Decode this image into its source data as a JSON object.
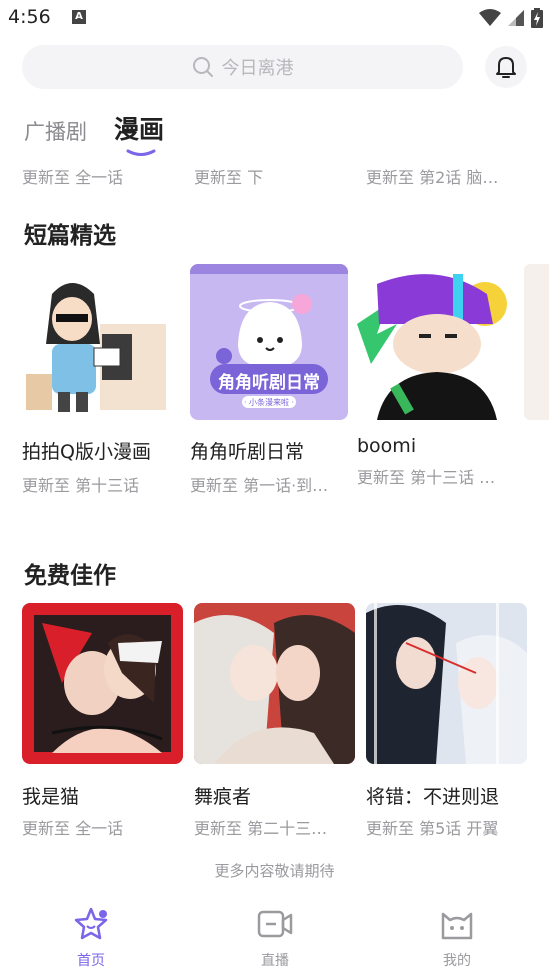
{
  "status_bar": {
    "time": "4:56",
    "notif_badge": "A"
  },
  "search": {
    "placeholder": "今日离港"
  },
  "tabs": [
    {
      "label": "广播剧"
    },
    {
      "label": "漫画"
    }
  ],
  "top_row_updates": [
    "更新至 全一话",
    "更新至 下",
    "更新至 第2话 脑…"
  ],
  "short_picks": {
    "title": "短篇精选",
    "items": [
      {
        "title": "拍拍Q版小漫画",
        "update": "更新至 第十三话"
      },
      {
        "title": "角角听剧日常",
        "update": "更新至 第一话·到…",
        "cover_caption": "角角听剧日常",
        "cover_subcaption": "· 小条漫来啦 ·"
      },
      {
        "title": "boomi",
        "update": "更新至 第十三话 …"
      }
    ]
  },
  "free_picks": {
    "title": "免费佳作",
    "items": [
      {
        "title": "我是猫",
        "update": "更新至 全一话"
      },
      {
        "title": "舞痕者",
        "update": "更新至 第二十三…"
      },
      {
        "title": "将错：不进则退",
        "update": "更新至 第5话 开翼"
      }
    ]
  },
  "footer_note": "更多内容敬请期待",
  "bottom_nav": [
    {
      "label": "首页",
      "icon": "star-face-icon",
      "active": true
    },
    {
      "label": "直播",
      "icon": "video-icon",
      "active": false
    },
    {
      "label": "我的",
      "icon": "cat-face-icon",
      "active": false
    }
  ],
  "colors": {
    "accent": "#7b66ea",
    "muted": "#9a9a9f",
    "search_bg": "#f4f4f6"
  }
}
